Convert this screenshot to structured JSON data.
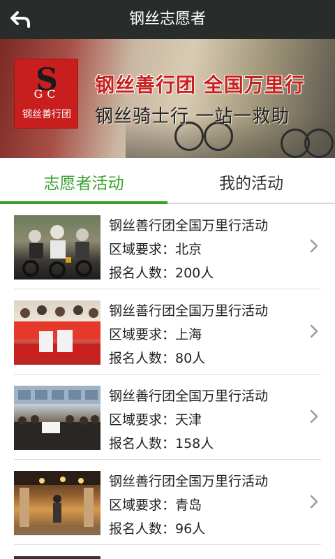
{
  "header": {
    "title": "钢丝志愿者",
    "back_icon": "back-arrow-icon"
  },
  "banner": {
    "logo_mark": "S",
    "logo_letters": "GC",
    "logo_name": "钢丝善行团",
    "headline": "钢丝善行团 全国万里行",
    "subline": "钢丝骑士行 一站一救助",
    "dots_total": 5,
    "active_dot": 0
  },
  "tabs": [
    {
      "label": "志愿者活动",
      "active": true
    },
    {
      "label": "我的活动",
      "active": false
    }
  ],
  "activities": [
    {
      "title": "钢丝善行团全国万里行活动",
      "region": "区域要求：北京",
      "count": "报名人数：200人"
    },
    {
      "title": "钢丝善行团全国万里行活动",
      "region": "区域要求：上海",
      "count": "报名人数：80人"
    },
    {
      "title": "钢丝善行团全国万里行活动",
      "region": "区域要求：天津",
      "count": "报名人数：158人"
    },
    {
      "title": "钢丝善行团全国万里行活动",
      "region": "区域要求：青岛",
      "count": "报名人数：96人"
    }
  ],
  "colors": {
    "accent": "#3aa12e",
    "topbar": "#282d2b",
    "banner_red": "#c8201c"
  }
}
